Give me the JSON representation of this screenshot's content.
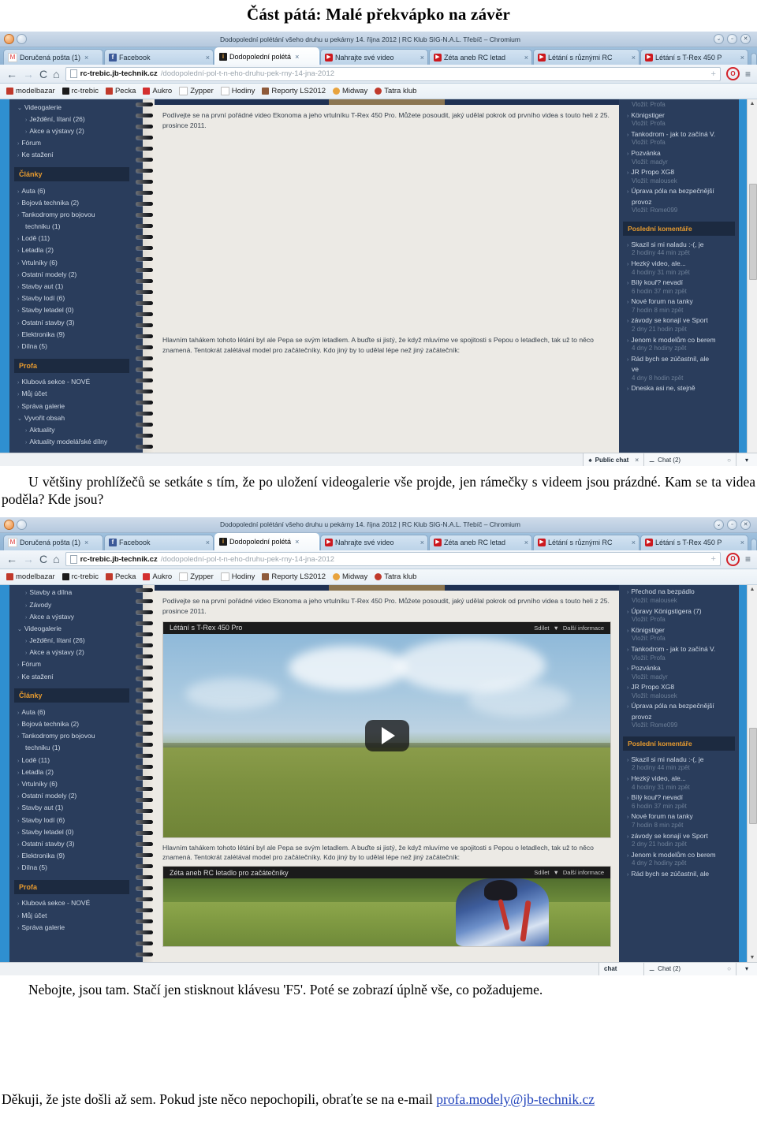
{
  "document": {
    "heading": "Část pátá: Malé překvápko na závěr",
    "paragraph_1": "U většiny prohlížečů se setkáte s tím, že po uložení videogalerie vše projde, jen rámečky s videem jsou prázdné. Kam se ta videa poděla? Kde jsou?",
    "paragraph_2": "Nebojte, jsou tam. Stačí jen stisknout klávesu 'F5'. Poté se zobrazí úplně vše, co požadujeme.",
    "closing_prefix": "Děkuji, že jste došli až sem. Pokud jste něco nepochopili, obraťte se na e-mail ",
    "closing_email": "profa.modely@jb-technik.cz"
  },
  "browser": {
    "window_title": "Dodopolední polétání všeho druhu u pekárny 14. října 2012 | RC Klub SIG-N.A.L. Třebíč – Chromium",
    "window_controls": {
      "minimize": "⌄",
      "maximize": "▫",
      "close": "✕"
    },
    "tabs": [
      {
        "label": "Doručená pošta (1)",
        "icon": "gmail-icon",
        "active": false
      },
      {
        "label": "Facebook",
        "icon": "facebook-icon",
        "active": false
      },
      {
        "label": "Dodopolední polétá",
        "icon": "rc-klub-icon",
        "active": true
      },
      {
        "label": "Nahrajte své video",
        "icon": "youtube-icon",
        "active": false
      },
      {
        "label": "Zéta aneb RC letad",
        "icon": "youtube-icon",
        "active": false
      },
      {
        "label": "Létání s různými RC",
        "icon": "youtube-icon",
        "active": false
      },
      {
        "label": "Létání s T-Rex 450 P",
        "icon": "youtube-icon",
        "active": false
      }
    ],
    "tab_close_glyph": "×",
    "nav": {
      "back": "←",
      "forward": "→",
      "reload": "C",
      "home": "⌂",
      "star": "+",
      "opera_label": "O",
      "menu": "≡"
    },
    "omnibox": {
      "host": "rc-trebic.jb-technik.cz",
      "path": "/dodopolední-pol-t-n-eho-druhu-pek-rny-14-jna-2012"
    },
    "bookmarks": [
      {
        "label": "modelbazar",
        "color": "#c0392b"
      },
      {
        "label": "rc-trebic",
        "color": "#1b1b1b"
      },
      {
        "label": "Pecka",
        "color": "#c0392b"
      },
      {
        "label": "Aukro",
        "color": "#d32f2f"
      },
      {
        "label": "Zypper",
        "color": "#ffffff"
      },
      {
        "label": "Hodiny",
        "color": "#ffffff"
      },
      {
        "label": "Reporty LS2012",
        "color": "#8e5a3a"
      },
      {
        "label": "Midway",
        "color": "#e8a33d"
      },
      {
        "label": "Tatra klub",
        "color": "#c0392b"
      }
    ]
  },
  "shot1": {
    "sidebar": {
      "items_top": [
        {
          "label": "Videogalerie",
          "level": 1,
          "arrow": "⌄"
        },
        {
          "label": "Ježdění, lítaní (26)",
          "level": 2,
          "arrow": "›"
        },
        {
          "label": "Akce a výstavy (2)",
          "level": 2,
          "arrow": "›"
        },
        {
          "label": "Fórum",
          "level": 1,
          "arrow": "›"
        },
        {
          "label": "Ke stažení",
          "level": 1,
          "arrow": "›"
        }
      ],
      "section_clanky": "Články",
      "items_clanky": [
        {
          "label": "Auta (6)",
          "arrow": "›"
        },
        {
          "label": "Bojová technika (2)",
          "arrow": "›"
        },
        {
          "label": "Tankodromy pro bojovou",
          "arrow": "›"
        },
        {
          "label": "techniku (1)",
          "arrow": ""
        },
        {
          "label": "Lodě (11)",
          "arrow": "›"
        },
        {
          "label": "Letadla (2)",
          "arrow": "›"
        },
        {
          "label": "Vrtulníky (6)",
          "arrow": "›"
        },
        {
          "label": "Ostatní modely (2)",
          "arrow": "›"
        },
        {
          "label": "Stavby aut (1)",
          "arrow": "›"
        },
        {
          "label": "Stavby lodí (6)",
          "arrow": "›"
        },
        {
          "label": "Stavby letadel (0)",
          "arrow": "›"
        },
        {
          "label": "Ostatní stavby (3)",
          "arrow": "›"
        },
        {
          "label": "Elektronika (9)",
          "arrow": "›"
        },
        {
          "label": "Dílna (5)",
          "arrow": "›"
        }
      ],
      "section_profa": "Profa",
      "items_profa": [
        {
          "label": "Klubová sekce - NOVÉ",
          "level": 1,
          "arrow": "›"
        },
        {
          "label": "Můj účet",
          "level": 1,
          "arrow": "›"
        },
        {
          "label": "Správa galerie",
          "level": 1,
          "arrow": "›"
        },
        {
          "label": "Vyvořit obsah",
          "level": 1,
          "arrow": "⌄"
        },
        {
          "label": "Aktuality",
          "level": 2,
          "arrow": "›"
        },
        {
          "label": "Aktuality modelářské dílny",
          "level": 2,
          "arrow": "›"
        }
      ]
    },
    "content": {
      "para1": "Podívejte se na první pořádné video Ekonoma a jeho vrtulníku T-Rex 450 Pro. Můžete posoudit, jaký udělal pokrok od prvního videa s touto heli z 25. prosince 2011.",
      "para2": "Hlavním tahákem tohoto létání byl ale Pepa se svým letadlem. A buďte si jistý, že když mluvíme ve spojitosti s Pepou o letadlech, tak už to něco znamená. Tentokrát zalétával model pro začátečníky. Kdo jiný by to udělal lépe než jiný začátečník:"
    },
    "rightbar": {
      "items": [
        {
          "title": "Vložil: Profa",
          "muted": true
        },
        {
          "title": "Königstiger",
          "arrow": "›"
        },
        {
          "title": "Vložil: Profa",
          "muted": true
        },
        {
          "title": "Tankodrom - jak to začíná V.",
          "arrow": "›"
        },
        {
          "title": "Vložil: Profa",
          "muted": true
        },
        {
          "title": "Pozvánka",
          "arrow": "›"
        },
        {
          "title": "Vložil: madyr",
          "muted": true
        },
        {
          "title": "JR Propo XG8",
          "arrow": "›"
        },
        {
          "title": "Vložil: malousek",
          "muted": true
        },
        {
          "title": "Úprava póla na bezpečnější",
          "arrow": "›"
        },
        {
          "title": "provoz",
          "wrap": true
        },
        {
          "title": "Vložil: Rome099",
          "muted": true
        }
      ],
      "section_comments": "Poslední komentáře",
      "comments": [
        {
          "title": "Skazil si mi naladu :-(, je",
          "time": "2 hodiny 44 min zpět"
        },
        {
          "title": "Hezký video, ale...",
          "time": "4 hodiny 31 min zpět"
        },
        {
          "title": "Bílý kouř? nevadí",
          "time": "6 hodin 37 min zpět"
        },
        {
          "title": "Nové forum na tanky",
          "time": "7 hodin 8 min zpět"
        },
        {
          "title": "závody se konají ve Sport",
          "time": "2 dny 21 hodin zpět"
        },
        {
          "title": "Jenom k modelům co berem",
          "time": "4 dny 2 hodiny zpět"
        },
        {
          "title": "Rád bych se zúčastnil, ale",
          "time": ""
        },
        {
          "title": "ve",
          "time": "4 dny 8 hodin zpět",
          "wrap": true
        },
        {
          "title": "Dneska asi ne, stejně",
          "time": ""
        }
      ]
    },
    "chatbar": {
      "public_chat": "Public chat",
      "public_chat_close": "×",
      "chat": "Chat (2)",
      "gear": "○"
    }
  },
  "shot2": {
    "sidebar": {
      "items_top": [
        {
          "label": "Stavby a dílna",
          "level": 2,
          "arrow": "›"
        },
        {
          "label": "Závody",
          "level": 2,
          "arrow": "›"
        },
        {
          "label": "Akce a výstavy",
          "level": 2,
          "arrow": "›"
        },
        {
          "label": "Videogalerie",
          "level": 1,
          "arrow": "⌄"
        },
        {
          "label": "Ježdění, lítaní (26)",
          "level": 2,
          "arrow": "›"
        },
        {
          "label": "Akce a výstavy (2)",
          "level": 2,
          "arrow": "›"
        },
        {
          "label": "Fórum",
          "level": 1,
          "arrow": "›"
        },
        {
          "label": "Ke stažení",
          "level": 1,
          "arrow": "›"
        }
      ],
      "section_clanky": "Články",
      "items_clanky": [
        {
          "label": "Auta (6)",
          "arrow": "›"
        },
        {
          "label": "Bojová technika (2)",
          "arrow": "›"
        },
        {
          "label": "Tankodromy pro bojovou",
          "arrow": "›"
        },
        {
          "label": "techniku (1)",
          "arrow": ""
        },
        {
          "label": "Lodě (11)",
          "arrow": "›"
        },
        {
          "label": "Letadla (2)",
          "arrow": "›"
        },
        {
          "label": "Vrtulníky (6)",
          "arrow": "›"
        },
        {
          "label": "Ostatní modely (2)",
          "arrow": "›"
        },
        {
          "label": "Stavby aut (1)",
          "arrow": "›"
        },
        {
          "label": "Stavby lodí (6)",
          "arrow": "›"
        },
        {
          "label": "Stavby letadel (0)",
          "arrow": "›"
        },
        {
          "label": "Ostatní stavby (3)",
          "arrow": "›"
        },
        {
          "label": "Elektronika (9)",
          "arrow": "›"
        },
        {
          "label": "Dílna (5)",
          "arrow": "›"
        }
      ],
      "section_profa": "Profa",
      "items_profa": [
        {
          "label": "Klubová sekce - NOVÉ",
          "arrow": "›"
        },
        {
          "label": "Můj účet",
          "arrow": "›"
        },
        {
          "label": "Správa galerie",
          "arrow": "›"
        }
      ]
    },
    "content": {
      "para1": "Podívejte se na první pořádné video Ekonoma a jeho vrtulníku T-Rex 450 Pro. Můžete posoudit, jaký udělal pokrok od prvního videa s touto heli z 25. prosince 2011.",
      "para2": "Hlavním tahákem tohoto létání byl ale Pepa se svým letadlem. A buďte si jistý, že když mluvíme ve spojitosti s Pepou o letadlech, tak už to něco znamená. Tentokrát zalétával model pro začátečníky. Kdo jiný by to udělal lépe než jiný začátečník:"
    },
    "video1": {
      "title": "Létání s T-Rex 450 Pro",
      "share": "Sdílet",
      "share_caret": "▼",
      "more_info": "Další informace",
      "play": "▶"
    },
    "video2": {
      "title": "Zéta aneb RC letadlo pro začátečníky",
      "share": "Sdílet",
      "share_caret": "▼",
      "more_info": "Další informace"
    },
    "rightbar": {
      "items": [
        {
          "title": "Přechod na bezpádlo",
          "arrow": "›"
        },
        {
          "title": "Vložil: malousek",
          "muted": true
        },
        {
          "title": "Úpravy Königstigera (7)",
          "arrow": "›"
        },
        {
          "title": "Vložil: Profa",
          "muted": true
        },
        {
          "title": "Königstiger",
          "arrow": "›"
        },
        {
          "title": "Vložil: Profa",
          "muted": true
        },
        {
          "title": "Tankodrom - jak to začíná V.",
          "arrow": "›"
        },
        {
          "title": "Vložil: Profa",
          "muted": true
        },
        {
          "title": "Pozvánka",
          "arrow": "›"
        },
        {
          "title": "Vložil: madyr",
          "muted": true
        },
        {
          "title": "JR Propo XG8",
          "arrow": "›"
        },
        {
          "title": "Vložil: malousek",
          "muted": true
        },
        {
          "title": "Úprava póla na bezpečnější",
          "arrow": "›"
        },
        {
          "title": "provoz",
          "wrap": true
        },
        {
          "title": "Vložil: Rome099",
          "muted": true
        }
      ],
      "section_comments": "Poslední komentáře",
      "comments": [
        {
          "title": "Skazil si mi naladu :-(, je",
          "time": "2 hodiny 44 min zpět"
        },
        {
          "title": "Hezký video, ale...",
          "time": "4 hodiny 31 min zpět"
        },
        {
          "title": "Bílý kouř? nevadí",
          "time": "6 hodin 37 min zpět"
        },
        {
          "title": "Nové forum na tanky",
          "time": "7 hodin 8 min zpět"
        },
        {
          "title": "závody se konají ve Sport",
          "time": "2 dny 21 hodin zpět"
        },
        {
          "title": "Jenom k modelům co berem",
          "time": "4 dny 2 hodiny zpět"
        },
        {
          "title": "Rád bych se zúčastnil, ale",
          "time": ""
        }
      ]
    },
    "chatbar": {
      "public_chat": "chat",
      "chat": "Chat (2)",
      "gear": "○"
    }
  }
}
